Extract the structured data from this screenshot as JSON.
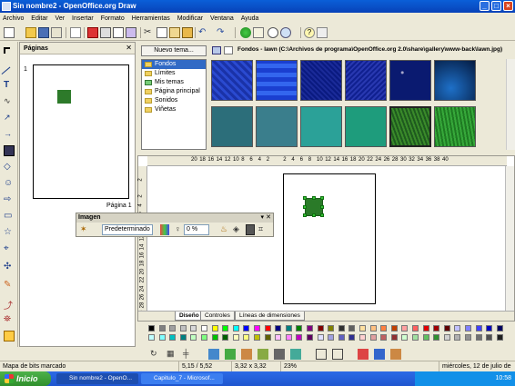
{
  "window": {
    "title": "Sin nombre2 - OpenOffice.org Draw"
  },
  "menu": [
    "Archivo",
    "Editar",
    "Ver",
    "Insertar",
    "Formato",
    "Herramientas",
    "Modificar",
    "Ventana",
    "Ayuda"
  ],
  "pages_panel": {
    "title": "Páginas",
    "page_number": "1",
    "page_label": "Página 1"
  },
  "gallery": {
    "new_theme_button": "Nuevo tema...",
    "themes": [
      "Fondos",
      "Límites",
      "Mis temas",
      "Página principal",
      "Sonidos",
      "Viñetas"
    ],
    "selected_theme": "Fondos",
    "title": "Fondos - lawn (C:\\Archivos de programa\\OpenOffice.org 2.0\\share\\gallery\\www-back\\lawn.jpg)"
  },
  "ruler": {
    "h_ticks": [
      "20",
      "18",
      "16",
      "14",
      "12",
      "10",
      "8",
      "6",
      "4",
      "2",
      "",
      "2",
      "4",
      "6",
      "8",
      "10",
      "12",
      "14",
      "16",
      "18",
      "20",
      "22",
      "24",
      "26",
      "28",
      "30",
      "32",
      "34",
      "36",
      "38",
      "40"
    ],
    "v_ticks": [
      "2",
      "",
      "2",
      "4",
      "6",
      "8",
      "10",
      "12",
      "14",
      "16",
      "18",
      "20",
      "22",
      "24",
      "26",
      "28",
      "30"
    ]
  },
  "tabs": [
    "Diseño",
    "Controles",
    "Líneas de dimensiones"
  ],
  "image_toolbar": {
    "title": "Imagen",
    "mode_select": "Predeterminado",
    "transparency": "0 %"
  },
  "status": {
    "message": "Mapa de bits marcado",
    "position": "5,15 / 5,52",
    "size": "3,32 x 3,32",
    "zoom": "23%",
    "date": "miércoles, 12 de julio de 2006"
  },
  "taskbar": {
    "start": "Inicio",
    "tasks": [
      "Sin nombre2 - OpenO...",
      "Capitulo_7 - Microsof..."
    ],
    "clock": "10:58"
  }
}
